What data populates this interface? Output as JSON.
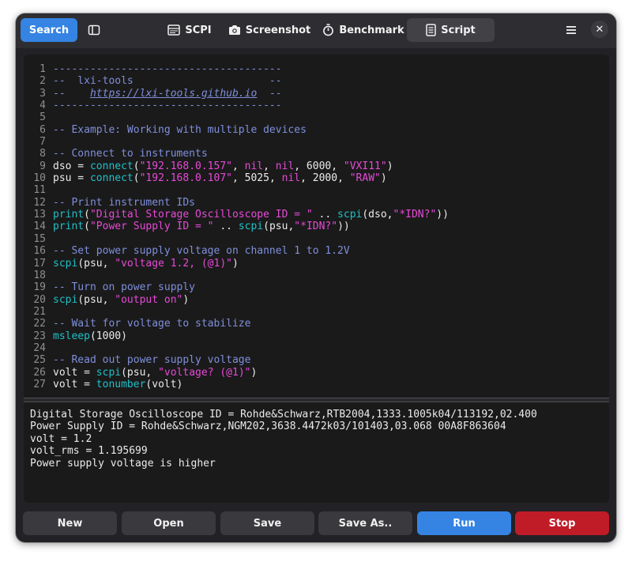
{
  "header": {
    "search_label": "Search",
    "tabs": [
      {
        "label": "SCPI",
        "icon": "terminal-icon"
      },
      {
        "label": "Screenshot",
        "icon": "camera-icon"
      },
      {
        "label": "Benchmark",
        "icon": "stopwatch-icon"
      },
      {
        "label": "Script",
        "icon": "document-icon"
      }
    ],
    "active_tab": "Script",
    "close_glyph": "✕"
  },
  "editor": {
    "lines": [
      {
        "n": "1",
        "tokens": [
          {
            "t": "comment",
            "v": "-------------------------------------"
          }
        ]
      },
      {
        "n": "2",
        "tokens": [
          {
            "t": "comment",
            "v": "--  lxi-tools                      --"
          }
        ]
      },
      {
        "n": "3",
        "tokens": [
          {
            "t": "comment",
            "v": "--    "
          },
          {
            "t": "link",
            "v": "https://lxi-tools.github.io"
          },
          {
            "t": "comment",
            "v": "  --"
          }
        ]
      },
      {
        "n": "4",
        "tokens": [
          {
            "t": "comment",
            "v": "-------------------------------------"
          }
        ]
      },
      {
        "n": "5",
        "tokens": []
      },
      {
        "n": "6",
        "tokens": [
          {
            "t": "comment",
            "v": "-- Example: Working with multiple devices"
          }
        ]
      },
      {
        "n": "7",
        "tokens": []
      },
      {
        "n": "8",
        "tokens": [
          {
            "t": "comment",
            "v": "-- Connect to instruments"
          }
        ]
      },
      {
        "n": "9",
        "tokens": [
          {
            "t": "txt",
            "v": "dso = "
          },
          {
            "t": "fn",
            "v": "connect"
          },
          {
            "t": "txt",
            "v": "("
          },
          {
            "t": "str",
            "v": "\"192.168.0.157\""
          },
          {
            "t": "txt",
            "v": ", "
          },
          {
            "t": "kw",
            "v": "nil"
          },
          {
            "t": "txt",
            "v": ", "
          },
          {
            "t": "kw",
            "v": "nil"
          },
          {
            "t": "txt",
            "v": ", 6000, "
          },
          {
            "t": "str",
            "v": "\"VXI11\""
          },
          {
            "t": "txt",
            "v": ")"
          }
        ]
      },
      {
        "n": "10",
        "tokens": [
          {
            "t": "txt",
            "v": "psu = "
          },
          {
            "t": "fn",
            "v": "connect"
          },
          {
            "t": "txt",
            "v": "("
          },
          {
            "t": "str",
            "v": "\"192.168.0.107\""
          },
          {
            "t": "txt",
            "v": ", 5025, "
          },
          {
            "t": "kw",
            "v": "nil"
          },
          {
            "t": "txt",
            "v": ", 2000, "
          },
          {
            "t": "str",
            "v": "\"RAW\""
          },
          {
            "t": "txt",
            "v": ")"
          }
        ]
      },
      {
        "n": "11",
        "tokens": []
      },
      {
        "n": "12",
        "tokens": [
          {
            "t": "comment",
            "v": "-- Print instrument IDs"
          }
        ]
      },
      {
        "n": "13",
        "tokens": [
          {
            "t": "fn",
            "v": "print"
          },
          {
            "t": "txt",
            "v": "("
          },
          {
            "t": "str",
            "v": "\"Digital Storage Oscilloscope ID = \""
          },
          {
            "t": "txt",
            "v": " .. "
          },
          {
            "t": "fn",
            "v": "scpi"
          },
          {
            "t": "txt",
            "v": "(dso,"
          },
          {
            "t": "str",
            "v": "\"*IDN?\""
          },
          {
            "t": "txt",
            "v": "))"
          }
        ]
      },
      {
        "n": "14",
        "tokens": [
          {
            "t": "fn",
            "v": "print"
          },
          {
            "t": "txt",
            "v": "("
          },
          {
            "t": "str",
            "v": "\"Power Supply ID = \""
          },
          {
            "t": "txt",
            "v": " .. "
          },
          {
            "t": "fn",
            "v": "scpi"
          },
          {
            "t": "txt",
            "v": "(psu,"
          },
          {
            "t": "str",
            "v": "\"*IDN?\""
          },
          {
            "t": "txt",
            "v": "))"
          }
        ]
      },
      {
        "n": "15",
        "tokens": []
      },
      {
        "n": "16",
        "tokens": [
          {
            "t": "comment",
            "v": "-- Set power supply voltage on channel 1 to 1.2V"
          }
        ]
      },
      {
        "n": "17",
        "tokens": [
          {
            "t": "fn",
            "v": "scpi"
          },
          {
            "t": "txt",
            "v": "(psu, "
          },
          {
            "t": "str",
            "v": "\"voltage 1.2, (@1)\""
          },
          {
            "t": "txt",
            "v": ")"
          }
        ]
      },
      {
        "n": "18",
        "tokens": []
      },
      {
        "n": "19",
        "tokens": [
          {
            "t": "comment",
            "v": "-- Turn on power supply"
          }
        ]
      },
      {
        "n": "20",
        "tokens": [
          {
            "t": "fn",
            "v": "scpi"
          },
          {
            "t": "txt",
            "v": "(psu, "
          },
          {
            "t": "str",
            "v": "\"output on\""
          },
          {
            "t": "txt",
            "v": ")"
          }
        ]
      },
      {
        "n": "21",
        "tokens": []
      },
      {
        "n": "22",
        "tokens": [
          {
            "t": "comment",
            "v": "-- Wait for voltage to stabilize"
          }
        ]
      },
      {
        "n": "23",
        "tokens": [
          {
            "t": "fn",
            "v": "msleep"
          },
          {
            "t": "txt",
            "v": "(1000)"
          }
        ]
      },
      {
        "n": "24",
        "tokens": []
      },
      {
        "n": "25",
        "tokens": [
          {
            "t": "comment",
            "v": "-- Read out power supply voltage"
          }
        ]
      },
      {
        "n": "26",
        "tokens": [
          {
            "t": "txt",
            "v": "volt = "
          },
          {
            "t": "fn",
            "v": "scpi"
          },
          {
            "t": "txt",
            "v": "(psu, "
          },
          {
            "t": "str",
            "v": "\"voltage? (@1)\""
          },
          {
            "t": "txt",
            "v": ")"
          }
        ]
      },
      {
        "n": "27",
        "tokens": [
          {
            "t": "txt",
            "v": "volt = "
          },
          {
            "t": "fn",
            "v": "tonumber"
          },
          {
            "t": "txt",
            "v": "(volt)"
          }
        ]
      }
    ]
  },
  "output": {
    "lines": [
      "Digital Storage Oscilloscope ID = Rohde&Schwarz,RTB2004,1333.1005k04/113192,02.400",
      "Power Supply ID = Rohde&Schwarz,NGM202,3638.4472k03/101403,03.068 00A8F863604",
      "volt = 1.2",
      "volt_rms = 1.195699",
      "Power supply voltage is higher"
    ]
  },
  "buttons": {
    "new": "New",
    "open": "Open",
    "save": "Save",
    "save_as": "Save As..",
    "run": "Run",
    "stop": "Stop"
  },
  "colors": {
    "accent": "#3584e4",
    "destructive": "#c01c28",
    "comment": "#7f8fdc",
    "function": "#1fc0c8",
    "string": "#e64ad7"
  }
}
